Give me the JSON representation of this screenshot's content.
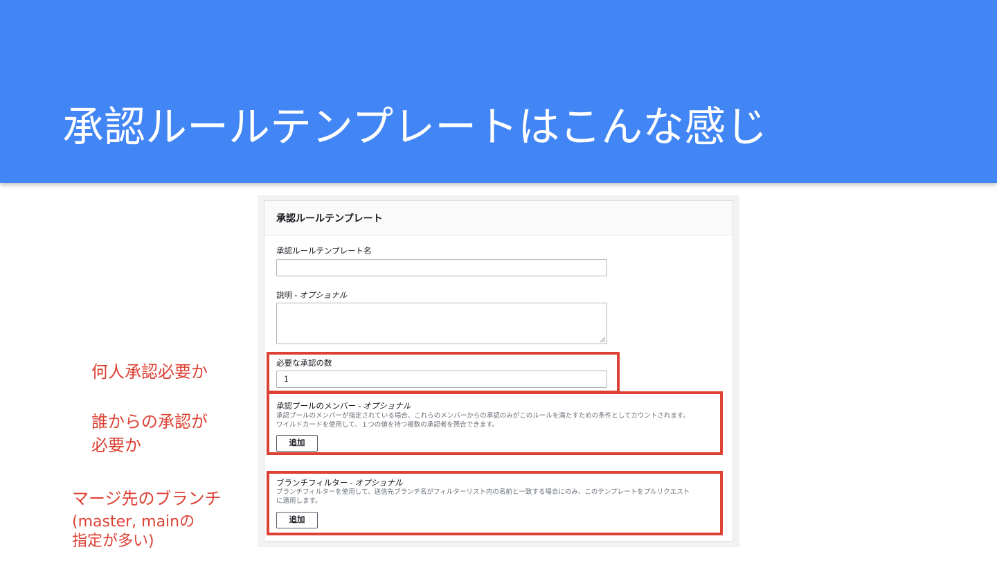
{
  "slide": {
    "title": "承認ルールテンプレートはこんな感じ"
  },
  "panel": {
    "title": "承認ルールテンプレート",
    "name_field": {
      "label": "承認ルールテンプレート名",
      "value": ""
    },
    "description_field": {
      "label": "説明",
      "label_optional": " - オプショナル",
      "value": ""
    },
    "approvals_field": {
      "label": "必要な承認の数",
      "value": "1"
    },
    "pool_members": {
      "label": "承認プールのメンバー",
      "label_optional": " - オプショナル",
      "description_line1": "承認プールのメンバーが指定されている場合、これらのメンバーからの承認のみがこのルールを満たすための条件としてカウントされます。",
      "description_line2": "ワイルドカードを使用して、１つの値を持つ複数の承認者を照合できます。",
      "add_button": "追加"
    },
    "branch_filter": {
      "label": "ブランチフィルター",
      "label_optional": " - オプショナル",
      "description_line1": "ブランチフィルターを使用して、送信先ブランチ名がフィルターリスト内の名前と一致する場合にのみ、このテンプレートをプルリクエスト",
      "description_line2": "に適用します。",
      "add_button": "追加"
    }
  },
  "annotations": {
    "approvals_note": "何人承認必要か",
    "pool_note_line1": "誰からの承認が",
    "pool_note_line2": "必要か",
    "branch_note_line1": "マージ先のブランチ",
    "branch_note_line2": "(master, mainの",
    "branch_note_line3": "指定が多い)"
  },
  "colors": {
    "header_blue": "#4285f4",
    "highlight_red": "#dd4134"
  }
}
